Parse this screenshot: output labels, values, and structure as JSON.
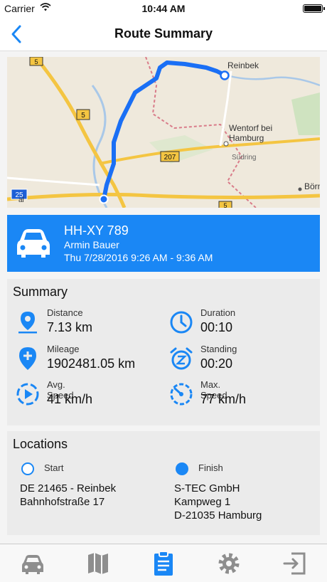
{
  "status_bar": {
    "carrier": "Carrier",
    "time": "10:44 AM"
  },
  "nav": {
    "title": "Route Summary",
    "back_icon": "chevron-left-icon"
  },
  "map": {
    "place_labels": [
      "Reinbek",
      "Wentorf bei",
      "Hamburg",
      "Südring",
      "Börn",
      "al"
    ],
    "road_shields": [
      "5",
      "5",
      "207",
      "25",
      "5"
    ],
    "route_color": "#1a6ff5"
  },
  "vehicle": {
    "plate": "HH-XY 789",
    "driver": "Armin Bauer",
    "time_range": "Thu 7/28/2016 9:26 AM - 9:36 AM",
    "card_color": "#1a87f5"
  },
  "summary": {
    "heading": "Summary",
    "metrics": [
      {
        "label": "Distance",
        "value": "7.13 km",
        "icon": "location-pin-icon"
      },
      {
        "label": "Duration",
        "value": "00:10",
        "icon": "clock-icon"
      },
      {
        "label": "Mileage",
        "value": "1902481.05 km",
        "icon": "location-pin-plus-icon"
      },
      {
        "label": "Standing",
        "value": "00:20",
        "icon": "alarm-z-icon"
      },
      {
        "label": "Avg. Speed",
        "value": "41 km/h",
        "icon": "play-circle-icon"
      },
      {
        "label": "Max. Speed",
        "value": "77 km/h",
        "icon": "speedometer-icon"
      }
    ]
  },
  "locations": {
    "heading": "Locations",
    "start": {
      "label": "Start",
      "line1": "DE 21465 - Reinbek",
      "line2": "Bahnhofstraße 17"
    },
    "finish": {
      "label": "Finish",
      "line1": "S-TEC GmbH",
      "line2": "Kampweg 1",
      "line3": "D-21035 Hamburg"
    }
  },
  "tab_bar": {
    "tabs": [
      {
        "icon": "car-icon",
        "active": false
      },
      {
        "icon": "map-icon",
        "active": false
      },
      {
        "icon": "clipboard-icon",
        "active": true
      },
      {
        "icon": "gear-icon",
        "active": false
      },
      {
        "icon": "logout-icon",
        "active": false
      }
    ],
    "active_color": "#1a87f5",
    "inactive_color": "#8e8e8e"
  }
}
